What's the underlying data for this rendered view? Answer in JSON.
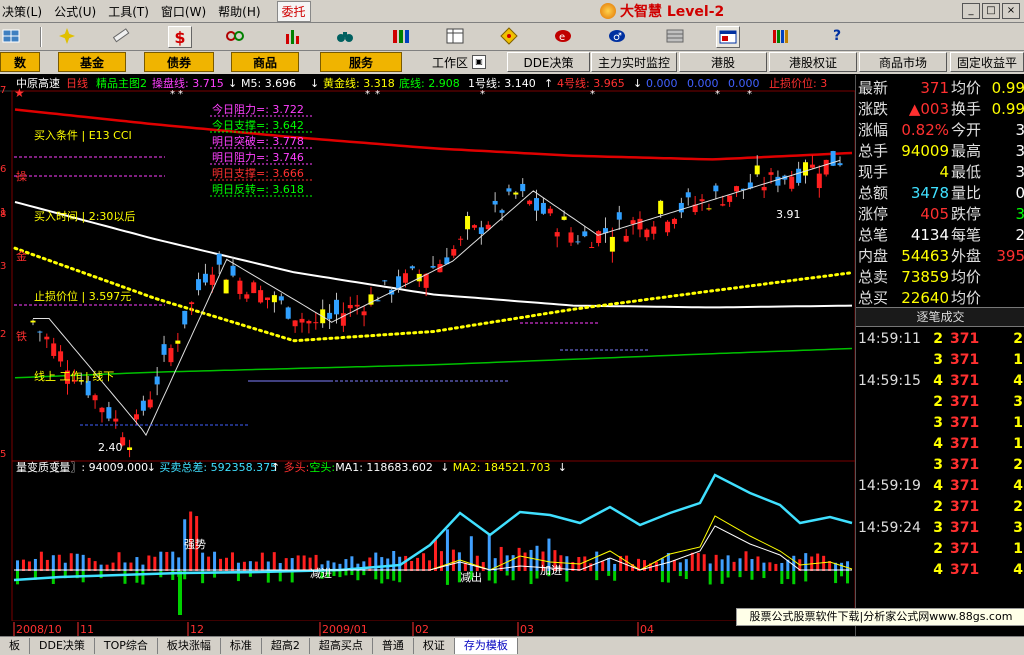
{
  "menu": {
    "items": [
      "决策(L)",
      "公式(U)",
      "工具(T)",
      "窗口(W)",
      "帮助(H)"
    ],
    "entrust": "委托",
    "brand": "大智慧 Level-2",
    "window_buttons": [
      "_",
      "□",
      "×"
    ]
  },
  "toolbar": {
    "icons": [
      "grid-icon",
      "crosshair-icon",
      "ruler-icon",
      "dollar-icon",
      "chain-icon",
      "bar-chart-icon",
      "binoculars-icon",
      "color-bars-icon",
      "table-icon",
      "diamond-icon",
      "globe-icon",
      "scale-icon",
      "grid2-icon",
      "window-icon",
      "books-icon",
      "help-icon"
    ]
  },
  "quick_buttons": {
    "left": [
      "数",
      "基金",
      "债券",
      "商品",
      "服务"
    ],
    "workarea": "工作区",
    "right": [
      "DDE决策",
      "主力实时监控",
      "港股",
      "港股权证",
      "商品市场",
      "固定收益平"
    ]
  },
  "chart": {
    "header": {
      "stock": "中原高速",
      "period": "日线",
      "template": "精品主图2",
      "items": [
        {
          "text": "操盘线: 3.715",
          "color": "#ff40ff"
        },
        {
          "text": "↓",
          "color": "#ffffff"
        },
        {
          "text": "M5: 3.696",
          "color": "#ffffff"
        },
        {
          "text": "↓",
          "color": "#ffffff"
        },
        {
          "text": "黄金线: 3.318",
          "color": "#ffff00"
        },
        {
          "text": "底线: 2.908",
          "color": "#00ff00"
        },
        {
          "text": "1号线: 3.140",
          "color": "#ffffff"
        },
        {
          "text": "↑",
          "color": "#ffffff"
        },
        {
          "text": "4号线: 3.965",
          "color": "#ff3030"
        },
        {
          "text": "↓",
          "color": "#ffffff"
        },
        {
          "text": "0.000",
          "color": "#4060ff"
        },
        {
          "text": "0.000",
          "color": "#4060ff"
        },
        {
          "text": "0.000",
          "color": "#4060ff"
        },
        {
          "text": "止损价位: 3",
          "color": "#ff3030"
        }
      ]
    },
    "left_labels": {
      "a": "买入条件 | E13 CCI",
      "b": "买入时间 | 2:30以后",
      "c": "止损价位 | 3.597元",
      "d": "线上 工作 | 线下",
      "cao": "操",
      "jin": "金",
      "tie": "铁"
    },
    "axis_marks": [
      "7",
      "6",
      "1",
      "8",
      "3",
      "2",
      "5"
    ],
    "levels": [
      {
        "label": "今日阻力=: 3.722",
        "color": "#ff40ff"
      },
      {
        "label": "今日支撑=: 3.642",
        "color": "#00ff00"
      },
      {
        "label": "明日突破=: 3.778",
        "color": "#ff40ff"
      },
      {
        "label": "明日阻力=: 3.746",
        "color": "#ff40ff"
      },
      {
        "label": "明日支撑=: 3.666",
        "color": "#ff3030"
      },
      {
        "label": "明日反转=: 3.618",
        "color": "#00ff00"
      }
    ],
    "annotations": {
      "high": "3.91",
      "low": "2.40"
    },
    "volume_header": [
      {
        "text": "量变质变",
        "color": "#ffffff"
      },
      {
        "text": "〖量〗: 94009.000",
        "color": "#ffffff"
      },
      {
        "text": "↓",
        "color": "#ffffff"
      },
      {
        "text": "买卖总差: 592358.375",
        "color": "#40e0ff"
      },
      {
        "text": "↑",
        "color": "#ffffff"
      },
      {
        "text": "多头:",
        "color": "#ff3030"
      },
      {
        "text": "空头:",
        "color": "#00ff00"
      },
      {
        "text": "MA1: 118683.602",
        "color": "#ffffff"
      },
      {
        "text": "↓",
        "color": "#ffffff"
      },
      {
        "text": "MA2: 184521.703",
        "color": "#ffff00"
      },
      {
        "text": "↓",
        "color": "#ffffff"
      }
    ],
    "volume_labels": {
      "strong": "强势",
      "in": "减进",
      "out": "减出",
      "ping": "加进"
    },
    "dates": [
      "2008/10",
      "11",
      "12",
      "2009/01",
      "02",
      "03",
      "04"
    ]
  },
  "quote": {
    "rows": [
      {
        "l1": "最新",
        "v1": "371",
        "c1": "#ff3030",
        "l2": "均价",
        "v2": "0.99",
        "c2": "#ffff00"
      },
      {
        "l1": "涨跌",
        "v1": "▲003",
        "c1": "#ff3030",
        "l2": "换手",
        "v2": "0.99",
        "c2": "#ffff00"
      },
      {
        "l1": "涨幅",
        "v1": "0.82%",
        "c1": "#ff3030",
        "l2": "今开",
        "v2": "3",
        "c2": "#ffffff"
      },
      {
        "l1": "总手",
        "v1": "94009",
        "c1": "#ffff00",
        "l2": "最高",
        "v2": "3",
        "c2": "#ffffff"
      },
      {
        "l1": "现手",
        "v1": "4",
        "c1": "#ffff00",
        "l2": "最低",
        "v2": "3",
        "c2": "#ffffff"
      },
      {
        "l1": "总额",
        "v1": "3478",
        "c1": "#40e0ff",
        "l2": "量比",
        "v2": "0",
        "c2": "#ffffff"
      },
      {
        "l1": "涨停",
        "v1": "405",
        "c1": "#ff3030",
        "l2": "跌停",
        "v2": "3",
        "c2": "#00ff00"
      },
      {
        "l1": "总笔",
        "v1": "4134",
        "c1": "#ffffff",
        "l2": "每笔",
        "v2": "2",
        "c2": "#ffffff"
      },
      {
        "l1": "内盘",
        "v1": "54463",
        "c1": "#ffff00",
        "l2": "外盘",
        "v2": "395",
        "c2": "#ff3030"
      },
      {
        "l1": "总卖",
        "v1": "73859",
        "c1": "#ffff00",
        "l2": "均价",
        "v2": "",
        "c2": "#ffffff"
      },
      {
        "l1": "总买",
        "v1": "22640",
        "c1": "#ffff00",
        "l2": "均价",
        "v2": "",
        "c2": "#ffffff"
      }
    ],
    "trade_title": "逐笔成交",
    "trades": [
      {
        "t": "14:59:11",
        "v": "2",
        "p": "371",
        "v2": "2"
      },
      {
        "t": "",
        "v": "3",
        "p": "371",
        "v2": "1"
      },
      {
        "t": "14:59:15",
        "v": "4",
        "p": "371",
        "v2": "4"
      },
      {
        "t": "",
        "v": "2",
        "p": "371",
        "v2": "3"
      },
      {
        "t": "",
        "v": "3",
        "p": "371",
        "v2": "1"
      },
      {
        "t": "",
        "v": "4",
        "p": "371",
        "v2": "1"
      },
      {
        "t": "",
        "v": "3",
        "p": "371",
        "v2": "2"
      },
      {
        "t": "14:59:19",
        "v": "4",
        "p": "371",
        "v2": "4"
      },
      {
        "t": "",
        "v": "2",
        "p": "371",
        "v2": "2"
      },
      {
        "t": "14:59:24",
        "v": "3",
        "p": "371",
        "v2": "3"
      },
      {
        "t": "",
        "v": "2",
        "p": "371",
        "v2": "1"
      },
      {
        "t": "",
        "v": "4",
        "p": "371",
        "v2": "4"
      }
    ]
  },
  "promo": "股票公式股票软件下载|分析家公式网www.88gs.com",
  "status_tabs": [
    "板",
    "DDE决策",
    "TOP综合",
    "板块涨幅",
    "标准",
    "超高2",
    "超高买点",
    "普通",
    "权证",
    "存为模板"
  ],
  "chart_data": {
    "type": "line",
    "title": "中原高速 日线",
    "x": [
      "2008/10",
      "11",
      "12",
      "2009/01",
      "02",
      "03",
      "04"
    ],
    "series": [
      {
        "name": "4号线",
        "values": [
          4.2,
          4.12,
          4.05,
          3.99,
          3.95,
          3.93,
          3.965
        ]
      },
      {
        "name": "1号线",
        "values": [
          3.7,
          3.5,
          3.32,
          3.2,
          3.14,
          3.13,
          3.14
        ]
      },
      {
        "name": "黄金线",
        "values": [
          3.45,
          3.18,
          2.95,
          3.0,
          3.12,
          3.22,
          3.318
        ]
      },
      {
        "name": "底线",
        "values": [
          2.75,
          2.78,
          2.8,
          2.82,
          2.85,
          2.88,
          2.908
        ]
      }
    ],
    "ylim": [
      2.3,
      4.3
    ]
  }
}
